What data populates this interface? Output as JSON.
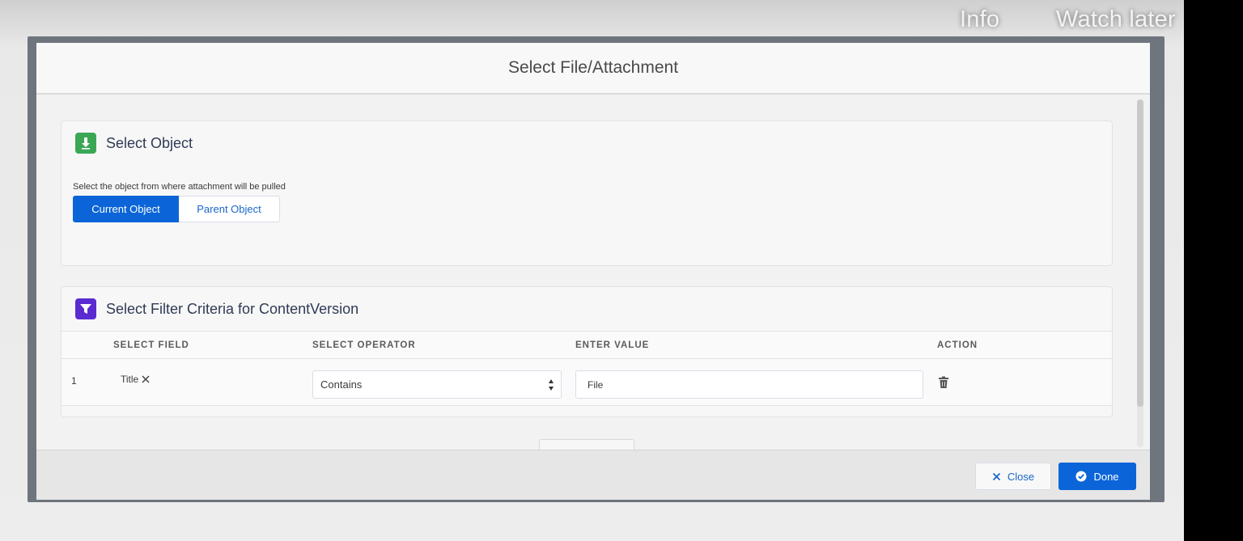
{
  "overlay": {
    "info_label": "Info",
    "watch_later_label": "Watch later"
  },
  "modal": {
    "title": "Select File/Attachment",
    "select_object": {
      "title": "Select Object",
      "icon": "download-icon",
      "helper_text": "Select the object from where attachment will be pulled",
      "options": [
        "Current Object",
        "Parent Object"
      ],
      "selected": "Current Object"
    },
    "filter": {
      "title": "Select Filter Criteria for ContentVersion",
      "icon": "filter-icon",
      "headers": {
        "field": "SELECT FIELD",
        "operator": "SELECT OPERATOR",
        "value": "ENTER VALUE",
        "action": "ACTION"
      },
      "rows": [
        {
          "num": "1",
          "field": "Title",
          "operator": "Contains",
          "value": "File"
        }
      ]
    },
    "footer": {
      "close_label": "Close",
      "done_label": "Done"
    }
  },
  "colors": {
    "brand_blue": "#0b65d8",
    "green_icon": "#3ba755",
    "purple_icon": "#5a2bd0"
  }
}
